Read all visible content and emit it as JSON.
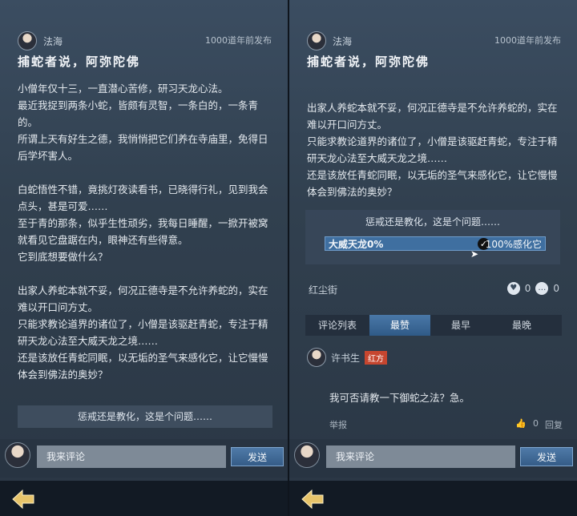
{
  "left": {
    "author": "法海",
    "time": "1000道年前发布",
    "title": "捕蛇者说，阿弥陀佛",
    "paragraphs": [
      "小僧年仅十三，一直潜心苦修，研习天龙心法。",
      "最近我捉到两条小蛇，皆颇有灵智，一条白的，一条青的。",
      "所谓上天有好生之德，我悄悄把它们养在寺庙里，免得日后学坏害人。",
      "",
      "白蛇悟性不错，竟挑灯夜读看书，已晓得行礼，见到我会点头，甚是可爱……",
      "至于青的那条，似乎生性顽劣，我每日睡醒，一掀开被窝就看见它盘踞在内，眼神还有些得意。",
      "它到底想要做什么？",
      "",
      "出家人养蛇本就不妥，何况正德寺是不允许养蛇的，实在难以开口问方丈。",
      "只能求教论道界的诸位了，小僧是该驱赶青蛇，专注于精研天龙心法至大威天龙之境……",
      "还是该放任青蛇同眠，以无垢的圣气来感化它，让它慢慢体会到佛法的奥妙？"
    ],
    "poll_question": "惩戒还是教化，这是个问题……",
    "comment_placeholder": "我来评论",
    "send_label": "发送"
  },
  "right": {
    "author": "法海",
    "time": "1000道年前发布",
    "title": "捕蛇者说，阿弥陀佛",
    "paragraphs": [
      "出家人养蛇本就不妥，何况正德寺是不允许养蛇的，实在难以开口问方丈。",
      "只能求教论道界的诸位了，小僧是该驱赶青蛇，专注于精研天龙心法至大威天龙之境……",
      "还是该放任青蛇同眠，以无垢的圣气来感化它，让它慢慢体会到佛法的奥妙？"
    ],
    "poll": {
      "question": "惩戒还是教化，这是个问题……",
      "left_option": "大威天龙0%",
      "right_option": "100%感化它",
      "right_share": 1.0
    },
    "location": "红尘街",
    "likes": "0",
    "comments_count": "0",
    "comment_tab_label": "评论列表",
    "tabs": [
      "最赞",
      "最早",
      "最晚"
    ],
    "comment": {
      "author": "许书生",
      "badge": "红方",
      "text": "我可否请教一下御蛇之法？急。",
      "report": "举报",
      "likes": "0",
      "reply": "回复"
    },
    "comment_placeholder": "我来评论",
    "send_label": "发送"
  },
  "colors": {
    "accent": "#3f6fa0",
    "badge": "#c6462f"
  },
  "icons": [
    "back-arrow-icon",
    "heart-icon",
    "comment-bubble-icon",
    "check-icon",
    "like-icon"
  ]
}
